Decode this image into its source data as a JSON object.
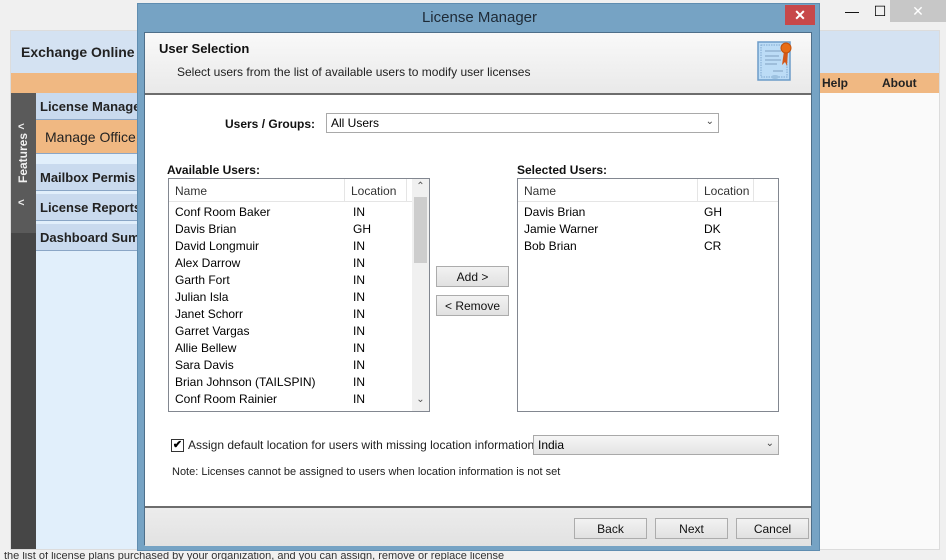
{
  "main_window": {
    "app_title": "Exchange Online R",
    "menu": [
      "Help",
      "About"
    ],
    "window_controls": {
      "minimize": "—",
      "maximize": "☐",
      "close": "✕"
    },
    "features_label": "Features",
    "features_arrows": [
      "<",
      "<"
    ],
    "nav_items": [
      {
        "label": "License Manage"
      },
      {
        "label": "Manage Office"
      },
      {
        "label": "Mailbox Permis"
      },
      {
        "label": "License Reports"
      },
      {
        "label": "Dashboard Sum"
      }
    ],
    "bottom_text": "the list of license plans purchased by your organization, and you can assign, remove or replace license"
  },
  "dialog": {
    "title": "License Manager",
    "close_glyph": "✕",
    "header": {
      "title": "User Selection",
      "subtitle": "Select users from the list of available users to modify user licenses",
      "icon": "certificate-icon"
    },
    "users_groups": {
      "label": "Users / Groups:",
      "value": "All Users"
    },
    "available_users": {
      "label": "Available Users:",
      "columns": [
        "Name",
        "Location"
      ],
      "rows": [
        {
          "name": "Conf Room Baker",
          "location": "IN"
        },
        {
          "name": "Davis  Brian",
          "location": "GH"
        },
        {
          "name": "David Longmuir",
          "location": "IN"
        },
        {
          "name": "Alex Darrow",
          "location": "IN"
        },
        {
          "name": "Garth Fort",
          "location": "IN"
        },
        {
          "name": "Julian Isla",
          "location": "IN"
        },
        {
          "name": "Janet Schorr",
          "location": "IN"
        },
        {
          "name": "Garret Vargas",
          "location": "IN"
        },
        {
          "name": "Allie Bellew",
          "location": "IN"
        },
        {
          "name": "Sara Davis",
          "location": "IN"
        },
        {
          "name": "Brian Johnson (TAILSPIN)",
          "location": "IN"
        },
        {
          "name": "Conf Room Rainier",
          "location": "IN"
        }
      ]
    },
    "add_button": "Add >",
    "remove_button": "< Remove",
    "selected_users": {
      "label": "Selected Users:",
      "columns": [
        "Name",
        "Location"
      ],
      "rows": [
        {
          "name": "Davis  Brian",
          "location": "GH"
        },
        {
          "name": "Jamie Warner",
          "location": "DK"
        },
        {
          "name": "Bob Brian",
          "location": "CR"
        }
      ]
    },
    "default_location": {
      "checked": true,
      "check_glyph": "✔",
      "label": "Assign default location for users with missing location information",
      "value": "India"
    },
    "note": "Note: Licenses cannot be assigned to users when location information is not set",
    "footer": {
      "back": "Back",
      "next": "Next",
      "cancel": "Cancel"
    },
    "colors": {
      "title_bar": "#76a3c4",
      "close": "#c7484a",
      "menu_bar": "#f0b882",
      "banner": "#d4e2f2"
    }
  }
}
